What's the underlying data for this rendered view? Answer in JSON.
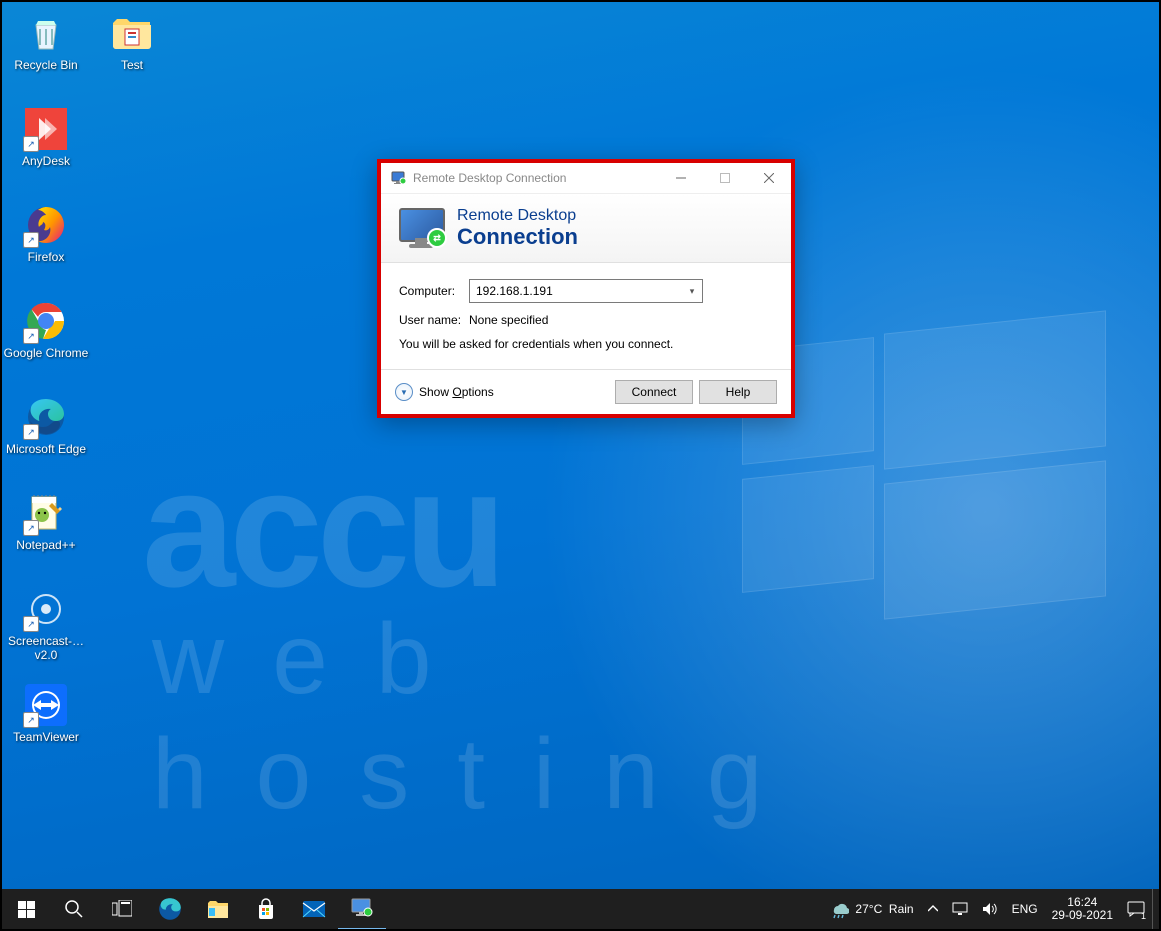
{
  "desktop_icons_col1": [
    {
      "label": "Recycle Bin",
      "key": "recycle-bin"
    },
    {
      "label": "AnyDesk",
      "key": "anydesk",
      "shortcut": true
    },
    {
      "label": "Firefox",
      "key": "firefox",
      "shortcut": true
    },
    {
      "label": "Google Chrome",
      "key": "chrome",
      "shortcut": true
    },
    {
      "label": "Microsoft Edge",
      "key": "edge",
      "shortcut": true
    },
    {
      "label": "Notepad++",
      "key": "notepadpp",
      "shortcut": true
    },
    {
      "label": "Screencast-… v2.0",
      "key": "screencast",
      "shortcut": true
    },
    {
      "label": "TeamViewer",
      "key": "teamviewer",
      "shortcut": true
    }
  ],
  "desktop_icons_col2": [
    {
      "label": "Test",
      "key": "test-folder"
    }
  ],
  "watermark": {
    "line1": "accu",
    "line2": "web hosting"
  },
  "dialog": {
    "title": "Remote Desktop Connection",
    "banner_line1": "Remote Desktop",
    "banner_line2": "Connection",
    "computer_label": "Computer:",
    "computer_value": "192.168.1.191",
    "username_label": "User name:",
    "username_value": "None specified",
    "hint": "You will be asked for credentials when you connect.",
    "options_label": "Show Options",
    "connect_label": "Connect",
    "help_label": "Help"
  },
  "taskbar": {
    "weather_temp": "27°C",
    "weather_desc": "Rain",
    "lang": "ENG",
    "time": "16:24",
    "date": "29-09-2021",
    "notif_count": "1"
  }
}
